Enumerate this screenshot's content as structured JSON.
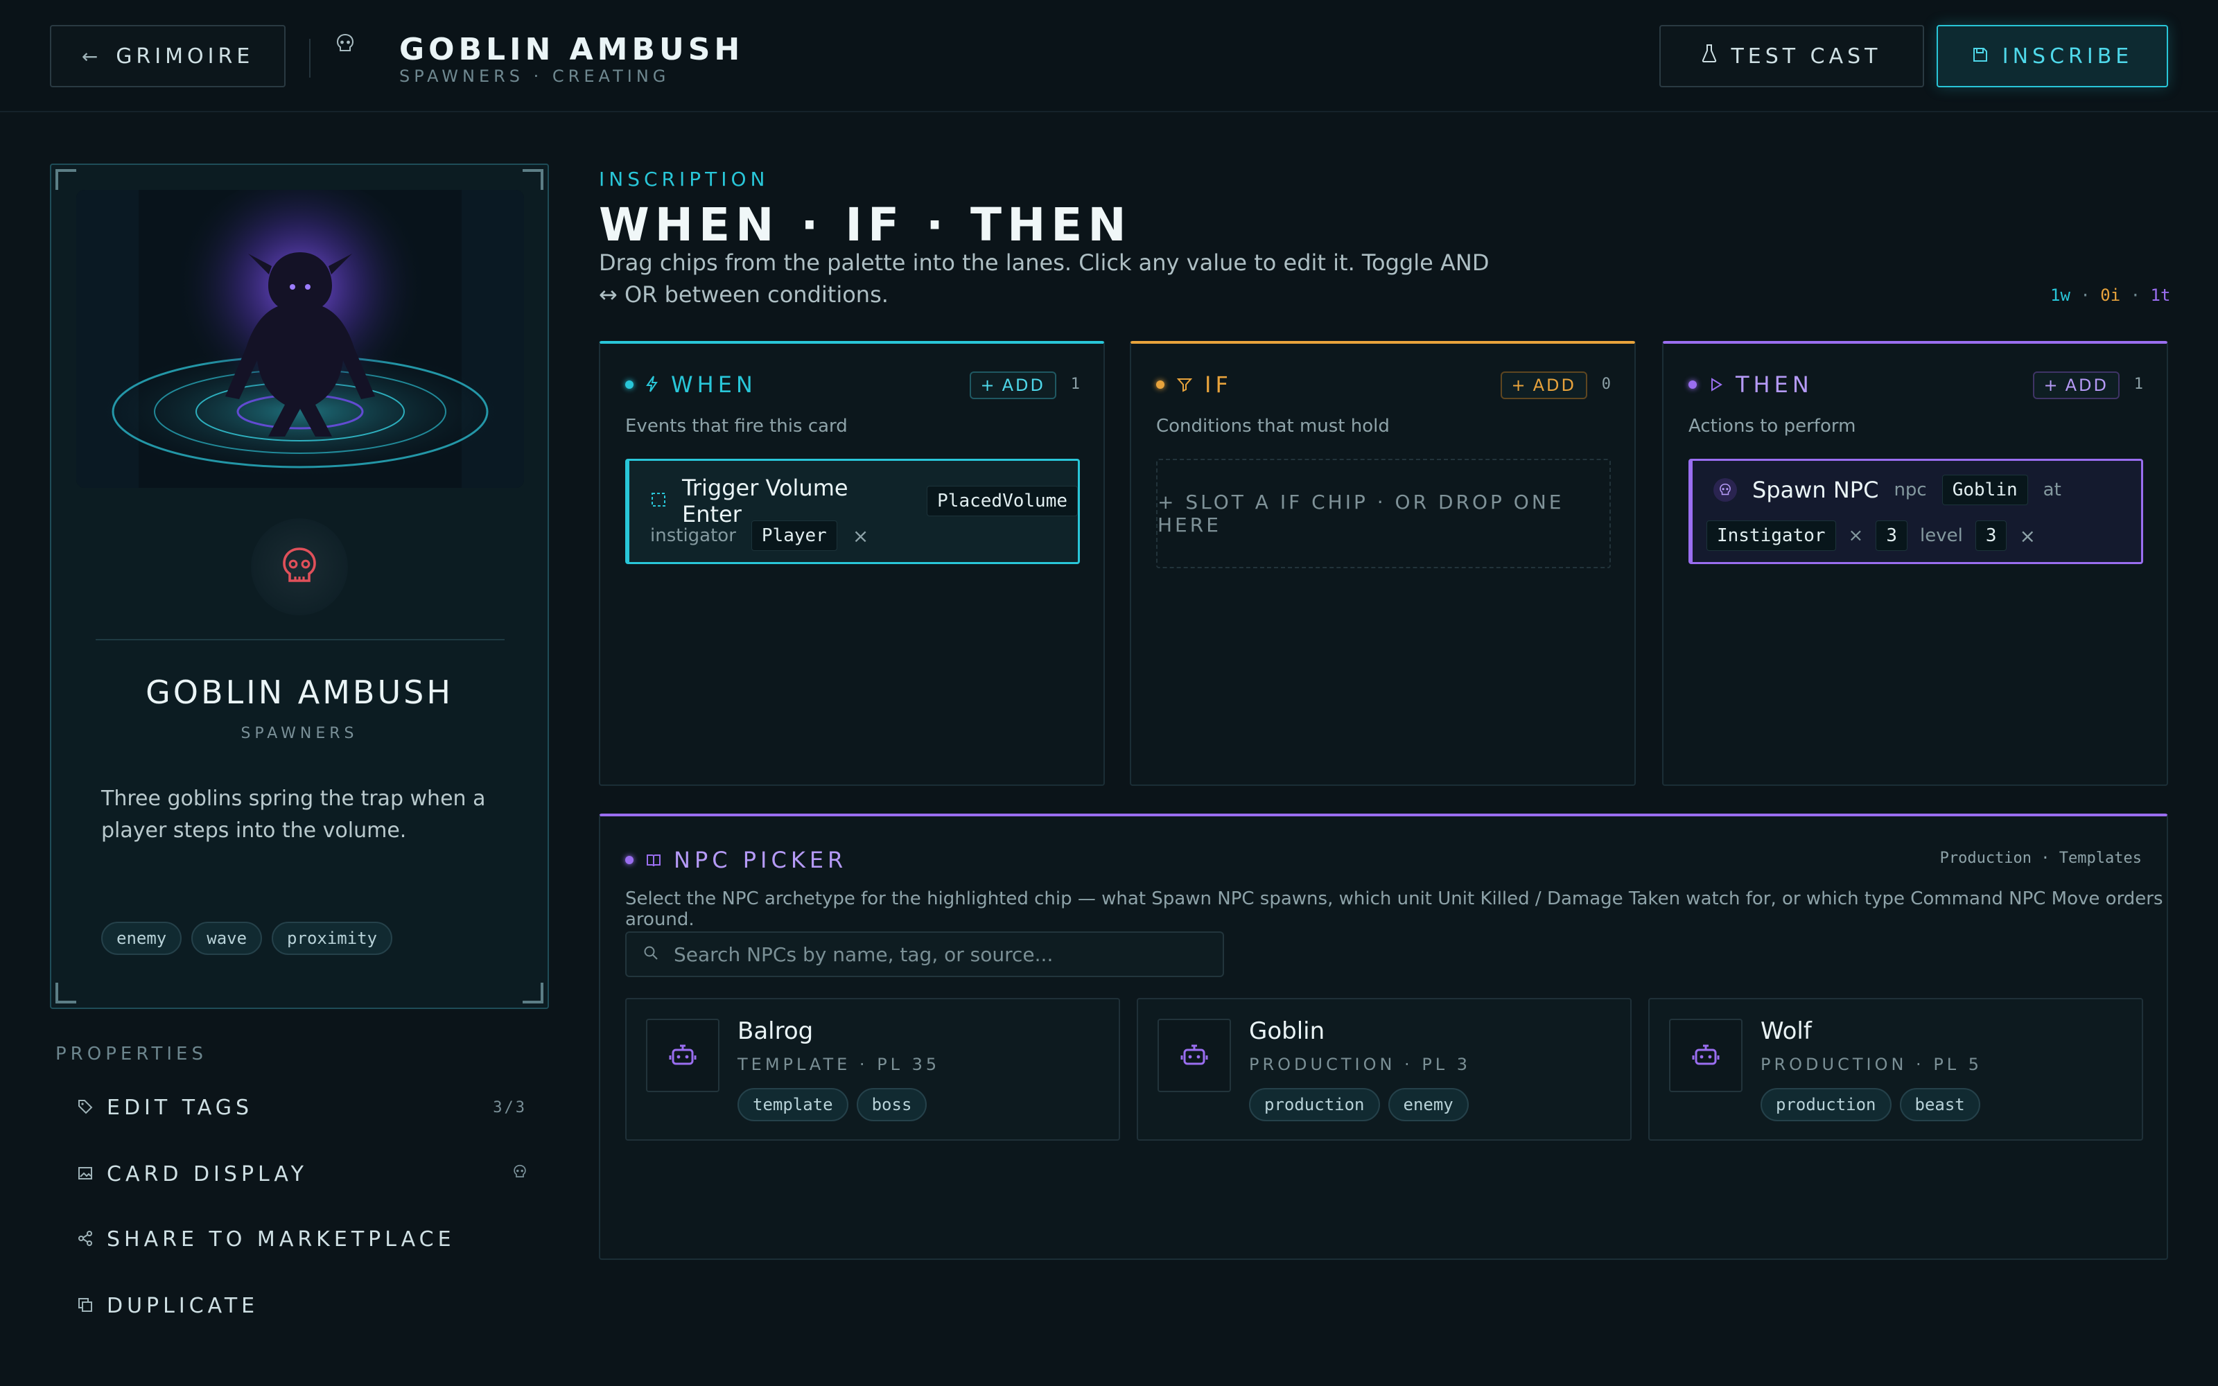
{
  "header": {
    "back_label": "Grimoire",
    "title": "GOBLIN AMBUSH",
    "subtitle": "SPAWNERS · CREATING",
    "test_label": "Test Cast",
    "inscribe_label": "Inscribe"
  },
  "card": {
    "title": "GOBLIN AMBUSH",
    "category": "Spawners",
    "description": "Three goblins spring the trap when a player steps into the volume.",
    "tags": [
      "enemy",
      "wave",
      "proximity"
    ]
  },
  "properties": {
    "heading": "Properties",
    "items": [
      {
        "label": "Edit Tags",
        "right": "3/3"
      },
      {
        "label": "Card Display",
        "right": ""
      },
      {
        "label": "Share to Marketplace",
        "right": ""
      },
      {
        "label": "Duplicate",
        "right": ""
      }
    ]
  },
  "main": {
    "eyebrow": "Inscription",
    "title": "WHEN · IF · THEN",
    "description": "Drag chips from the palette into the lanes. Click any value to edit it. Toggle AND ↔ OR between conditions.",
    "counts": {
      "w": "1w",
      "sep1": "·",
      "i": "0i",
      "sep2": "·",
      "t": "1t"
    }
  },
  "lanes": {
    "when": {
      "title": "When",
      "add_label": "Add",
      "count": "1",
      "subtitle": "Events that fire this card",
      "chip": {
        "name": "Trigger Volume Enter",
        "type_value": "PlacedVolume",
        "param_label": "instigator",
        "param_value": "Player",
        "remove": "×"
      }
    },
    "if": {
      "title": "If",
      "add_label": "Add",
      "count": "0",
      "subtitle": "Conditions that must hold",
      "slot": "+ Slot a IF chip · or drop one here"
    },
    "then": {
      "title": "Then",
      "add_label": "Add",
      "count": "1",
      "subtitle": "Actions to perform",
      "chip": {
        "name": "Spawn NPC",
        "npc_label": "npc",
        "npc_value": "Goblin",
        "at_label": "at",
        "at_value": "Instigator",
        "times": "×",
        "count_value": "3",
        "level_label": "level",
        "level_value": "3",
        "remove": "×"
      }
    }
  },
  "picker": {
    "title": "NPC Picker",
    "source": "Production · Templates",
    "description": "Select the NPC archetype for the highlighted chip — what Spawn NPC spawns, which unit Unit Killed / Damage Taken watch for, or which type Command NPC Move orders around.",
    "search_placeholder": "Search NPCs by name, tag, or source...",
    "npcs": [
      {
        "name": "Balrog",
        "meta": "TEMPLATE · PL 35",
        "tags": [
          "template",
          "boss"
        ]
      },
      {
        "name": "Goblin",
        "meta": "PRODUCTION · PL 3",
        "tags": [
          "production",
          "enemy"
        ]
      },
      {
        "name": "Wolf",
        "meta": "PRODUCTION · PL 5",
        "tags": [
          "production",
          "beast"
        ]
      }
    ]
  },
  "colors": {
    "cyan": "#29c6d8",
    "amber": "#e8a33c",
    "violet": "#9a6ef0",
    "skull_red": "#e0505a"
  }
}
